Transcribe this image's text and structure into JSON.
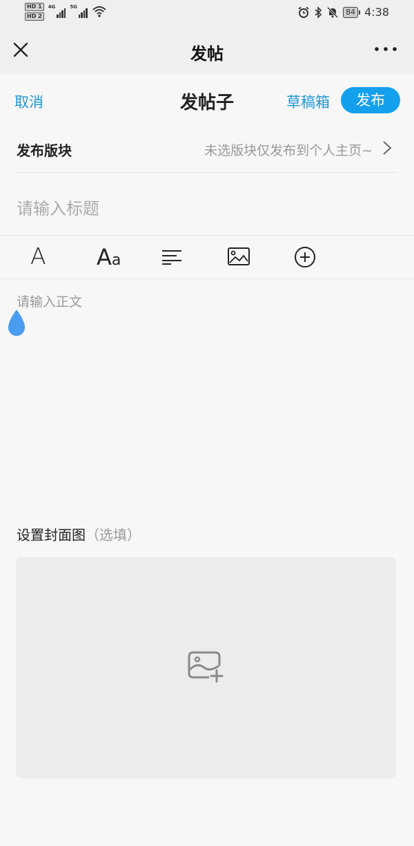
{
  "status_bar": {
    "sim1": "HD 1",
    "sim2": "HD 2",
    "net1": "4G",
    "net2": "5G",
    "battery": "84",
    "time": "4:38"
  },
  "titlebar": {
    "title": "发帖"
  },
  "header": {
    "cancel": "取消",
    "title": "发帖子",
    "drafts": "草稿箱",
    "publish": "发布"
  },
  "section": {
    "label": "发布版块",
    "hint": "未选版块仅发布到个人主页~"
  },
  "title_placeholder": "请输入标题",
  "toolbar": {
    "font_glyph": "A",
    "size_big": "A",
    "size_small": "a"
  },
  "body_placeholder": "请输入正文",
  "cover": {
    "label": "设置封面图",
    "optional": "（选填）"
  },
  "colors": {
    "accent": "#1e96d6",
    "publish_bg": "#14a0ec",
    "cursor_handle": "#4a9cf0"
  }
}
